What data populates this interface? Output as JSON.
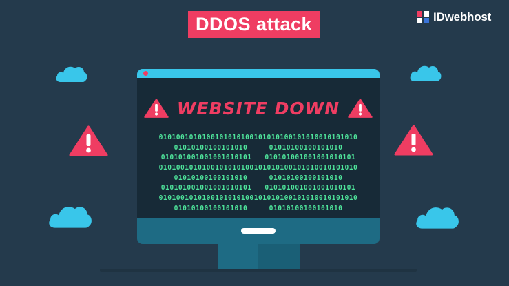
{
  "title": "DDOS attack",
  "brand": {
    "name": "IDwebhost",
    "logo_icon": "idwebhost-logo-icon"
  },
  "monitor": {
    "headline": "WEBSITE DOWN",
    "warning_icon": "warning-triangle-icon",
    "binary_lines": [
      "0101001010100101010100101010100101010010101010",
      "01010100100101010     01010100100101010",
      "010101001001001010101   010101001001001010101",
      "0101001010100101010100101010100101010010101010",
      "01010100100101010     01010100100101010",
      "010101001001001010101   010101001001001010101",
      "0101001010100101010100101010100101010010101010",
      "01010100100101010     01010100100101010"
    ]
  },
  "colors": {
    "background": "#243a4c",
    "accent_red": "#ef3d62",
    "cloud_blue": "#39c6ea",
    "binary_green": "#4ee39a",
    "monitor_frame": "#1e6b84",
    "screen": "#172a37"
  }
}
